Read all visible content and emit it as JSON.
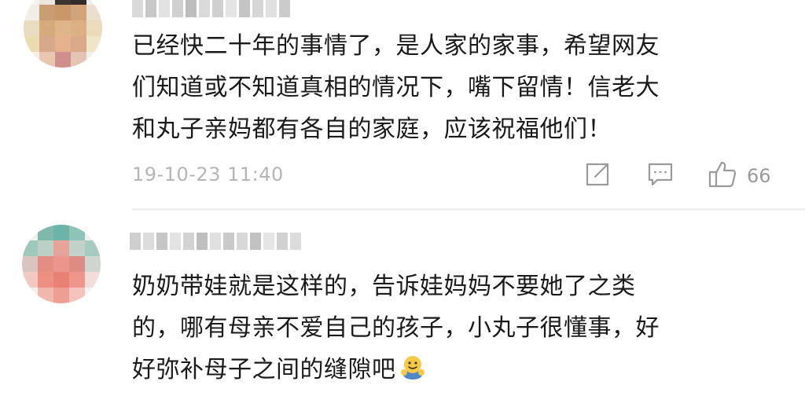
{
  "comments": [
    {
      "text_lines": [
        "已经快二十年的事情了，是人家的家事，希望网友",
        "们知道或不知道真相的情况下，嘴下留情！信老大",
        "和丸子亲妈都有各自的家庭，应该祝福他们！"
      ],
      "timestamp": "19-10-23 11:40",
      "like_count": "66",
      "avatar": "blurred-avatar",
      "username": "blurred-username"
    },
    {
      "text_lines": [
        "奶奶带娃就是这样的，告诉娃妈妈不要她了之类",
        "的，哪有母亲不爱自己的孩子，小丸子很懂事，好",
        "好弥补母子之间的缝隙吧"
      ],
      "emoji": "hugging-face-emoji",
      "avatar": "blurred-avatar",
      "username": "blurred-username"
    }
  ],
  "icons": {
    "share": "share-icon",
    "reply": "comment-icon",
    "like": "thumbs-up-icon"
  },
  "colors": {
    "text": "#1a1a1a",
    "meta": "#b5b5b5",
    "icon": "#9a9a9a",
    "divider": "#f0f0f0"
  }
}
